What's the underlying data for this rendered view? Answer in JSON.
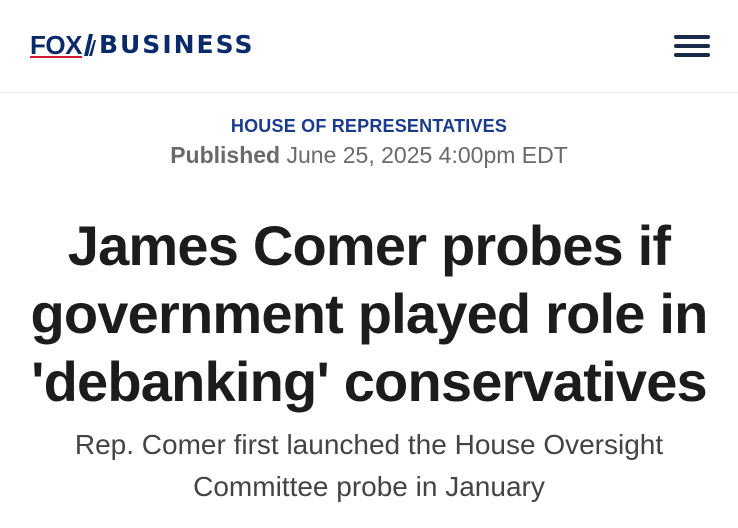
{
  "header": {
    "logo_fox": "FOX",
    "logo_business": "BUSINESS",
    "menu_icon": "hamburger-menu-icon"
  },
  "article": {
    "section": "HOUSE OF REPRESENTATIVES",
    "published_label": "Published",
    "published_date": "June 25, 2025 4:00pm EDT",
    "headline": "James Comer probes if government played role in 'debanking' conservatives",
    "subheadline": "Rep. Comer first launched the House Oversight Committee probe in January"
  },
  "colors": {
    "brand_navy": "#0b2a6b",
    "brand_red": "#d01f2e",
    "section_blue": "#1a3a8c"
  }
}
